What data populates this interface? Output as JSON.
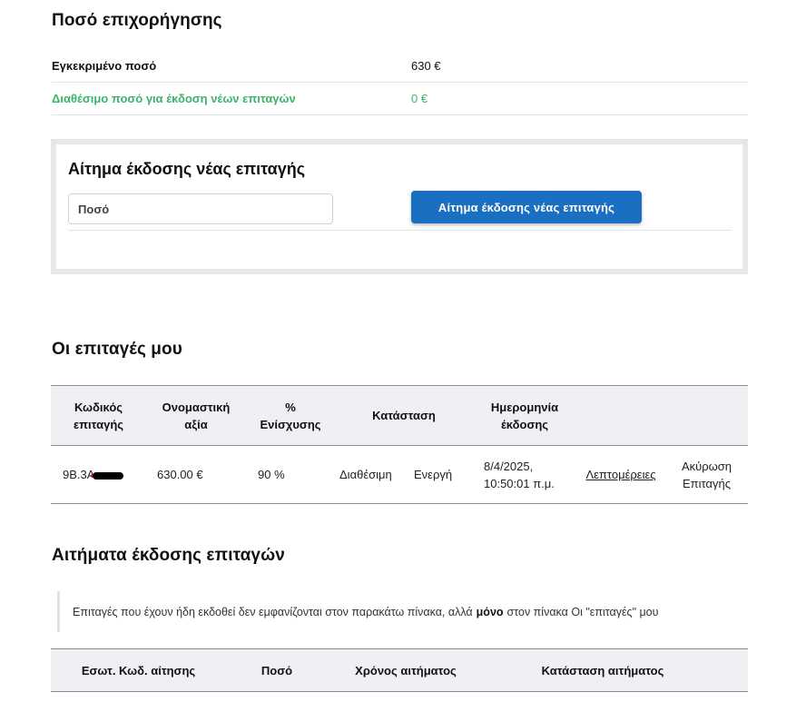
{
  "amount_section": {
    "title": "Ποσό επιχορήγησης",
    "approved_label": "Εγκεκριμένο ποσό",
    "approved_value": "630 €",
    "available_label": "Διαθέσιμο ποσό για έκδοση νέων επιταγών",
    "available_value": "0 €"
  },
  "request_box": {
    "title": "Αίτημα έκδοσης νέας επιταγής",
    "amount_placeholder": "Ποσό",
    "button_label": "Αίτημα έκδοσης νέας επιταγής"
  },
  "orders": {
    "title": "Οι επιταγές μου",
    "headers": {
      "code_line1": "Κωδικός",
      "code_line2": "επιταγής",
      "nominal_line1": "Ονομαστική",
      "nominal_line2": "αξία",
      "percent_line1": "%",
      "percent_line2": "Ενίσχυσης",
      "status": "Κατάσταση",
      "date_line1": "Ημερομηνία",
      "date_line2": "έκδοσης"
    },
    "rows": [
      {
        "code_prefix": "9B.3A",
        "nominal": "630.00 €",
        "percent": "90 %",
        "availability": "Διαθέσιμη",
        "state": "Ενεργή",
        "date_line1": "8/4/2025,",
        "date_line2": "10:50:01 π.μ.",
        "details_link": "Λεπτομέρειες",
        "cancel_line1": "Ακύρωση",
        "cancel_line2": "Επιταγής"
      }
    ]
  },
  "requests": {
    "title": "Αιτήματα έκδοσης επιταγών",
    "note_before": "Επιταγές που έχουν ήδη εκδοθεί δεν εμφανίζονται στον παρακάτω πίνακα, αλλά",
    "note_bold": "μόνο",
    "note_after": "στον πίνακα Οι \"επιταγές\" μου",
    "headers": {
      "internal_code": "Εσωτ. Κωδ. αίτησης",
      "amount": "Ποσό",
      "request_time": "Χρόνος αιτήματος",
      "request_status": "Κατάσταση αιτήματος"
    }
  },
  "colors": {
    "accent": "#1b6fc2",
    "available_green": "#3bb36b",
    "cancel_red": "#e01b1b",
    "link_blue": "#2a6ab8"
  }
}
